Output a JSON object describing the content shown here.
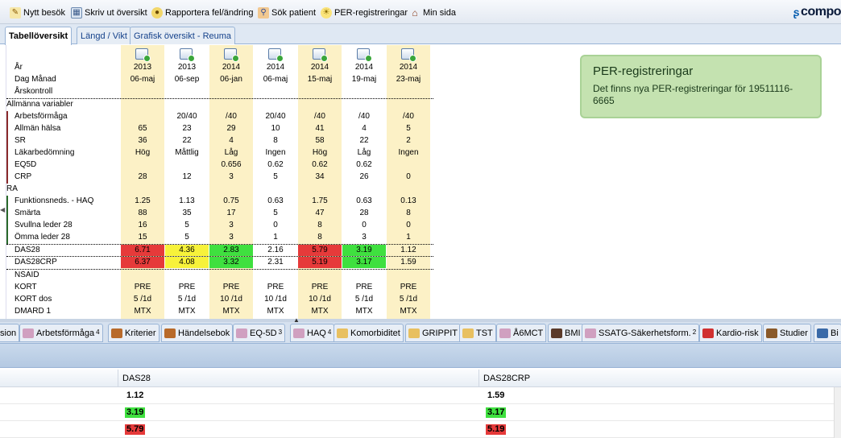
{
  "toolbar": {
    "items": [
      {
        "label": "Nytt besök",
        "icon": "pencil-icon"
      },
      {
        "label": "Skriv ut översikt",
        "icon": "table-icon"
      },
      {
        "label": "Rapportera fel/ändring",
        "icon": "report-icon"
      },
      {
        "label": "Sök patient",
        "icon": "search-person-icon"
      },
      {
        "label": "PER-registreringar",
        "icon": "lightbulb-icon"
      },
      {
        "label": "Min sida",
        "icon": "home-icon"
      }
    ],
    "brand": "compo"
  },
  "tabs": [
    {
      "label": "Tabellöversikt",
      "active": true
    },
    {
      "label": "Längd / Vikt",
      "active": false
    },
    {
      "label": "Grafisk översikt - Reuma",
      "active": false
    }
  ],
  "grid": {
    "header_labels": {
      "year": "År",
      "daymonth": "Dag Månad",
      "annual": "Årskontroll"
    },
    "columns": [
      {
        "year": "2013",
        "date": "06-maj"
      },
      {
        "year": "2013",
        "date": "06-sep"
      },
      {
        "year": "2014",
        "date": "06-jan"
      },
      {
        "year": "2014",
        "date": "06-maj"
      },
      {
        "year": "2014",
        "date": "15-maj"
      },
      {
        "year": "2014",
        "date": "19-maj"
      },
      {
        "year": "2014",
        "date": "23-maj"
      }
    ],
    "rows": [
      {
        "label": "Allmänna variabler",
        "values": [
          "",
          "",
          "",
          "",
          "",
          "",
          ""
        ]
      },
      {
        "label": "Arbetsförmåga",
        "values": [
          "",
          "20/40",
          "/40",
          "20/40",
          "/40",
          "/40",
          "/40"
        ]
      },
      {
        "label": "Allmän hälsa",
        "values": [
          "65",
          "23",
          "29",
          "10",
          "41",
          "4",
          "5"
        ]
      },
      {
        "label": "SR",
        "values": [
          "36",
          "22",
          "4",
          "8",
          "58",
          "22",
          "2"
        ]
      },
      {
        "label": "Läkarbedömning",
        "values": [
          "Hög",
          "Måttlig",
          "Låg",
          "Ingen",
          "Hög",
          "Låg",
          "Ingen"
        ]
      },
      {
        "label": "EQ5D",
        "values": [
          "",
          "",
          "0.656",
          "0.62",
          "0.62",
          "0.62",
          ""
        ]
      },
      {
        "label": "CRP",
        "values": [
          "28",
          "12",
          "3",
          "5",
          "34",
          "26",
          "0"
        ]
      },
      {
        "label": "RA",
        "values": [
          "",
          "",
          "",
          "",
          "",
          "",
          ""
        ]
      },
      {
        "label": "Funktionsneds. - HAQ",
        "values": [
          "1.25",
          "1.13",
          "0.75",
          "0.63",
          "1.75",
          "0.63",
          "0.13"
        ]
      },
      {
        "label": "Smärta",
        "values": [
          "88",
          "35",
          "17",
          "5",
          "47",
          "28",
          "8"
        ]
      },
      {
        "label": "Svullna leder 28",
        "values": [
          "16",
          "5",
          "3",
          "0",
          "8",
          "0",
          "0"
        ]
      },
      {
        "label": "Ömma leder 28",
        "values": [
          "15",
          "5",
          "3",
          "1",
          "8",
          "3",
          "1"
        ]
      },
      {
        "label": "DAS28",
        "values": [
          "6.71",
          "4.36",
          "2.83",
          "2.16",
          "5.79",
          "3.19",
          "1.12"
        ]
      },
      {
        "label": "DAS28CRP",
        "values": [
          "6.37",
          "4.08",
          "3.32",
          "2.31",
          "5.19",
          "3.17",
          "1.59"
        ]
      },
      {
        "label": "NSAID",
        "values": [
          "",
          "",
          "",
          "",
          "",
          "",
          ""
        ]
      },
      {
        "label": "KORT",
        "values": [
          "PRE",
          "PRE",
          "PRE",
          "PRE",
          "PRE",
          "PRE",
          "PRE"
        ]
      },
      {
        "label": "KORT dos",
        "values": [
          "5 /1d",
          "5 /1d",
          "10 /1d",
          "10 /1d",
          "10 /1d",
          "5 /1d",
          "5 /1d"
        ]
      },
      {
        "label": "DMARD 1",
        "values": [
          "MTX",
          "MTX",
          "MTX",
          "MTX",
          "MTX",
          "MTX",
          "MTX"
        ]
      }
    ],
    "colors": {
      "red": "#e63a3a",
      "yellow": "#f7f23a",
      "green": "#3fe03f",
      "column_bg": "#fcf1c6"
    }
  },
  "info": {
    "title": "PER-registreringar",
    "body": "Det finns nya PER-registreringar för 19511116-6665"
  },
  "bottom_tabs": [
    {
      "label": "sion",
      "badge": ""
    },
    {
      "label": "Arbetsförmåga",
      "badge": "4"
    },
    {
      "label": "Kriterier",
      "badge": ""
    },
    {
      "label": "Händelsebok",
      "badge": ""
    },
    {
      "label": "EQ-5D",
      "badge": "3"
    },
    {
      "label": "HAQ",
      "badge": "4"
    },
    {
      "label": "Komorbiditet",
      "badge": ""
    },
    {
      "label": "GRIPPIT",
      "badge": ""
    },
    {
      "label": "TST",
      "badge": ""
    },
    {
      "label": "Å6MCT",
      "badge": ""
    },
    {
      "label": "BMI",
      "badge": ""
    },
    {
      "label": "SSATG-Säkerhetsform.",
      "badge": "2"
    },
    {
      "label": "Kardio-risk",
      "badge": ""
    },
    {
      "label": "Studier",
      "badge": ""
    },
    {
      "label": "Bi",
      "badge": ""
    }
  ],
  "lower_table": {
    "headers": [
      "DAS28",
      "DAS28CRP"
    ],
    "rows": [
      {
        "das28": "1.12",
        "das28crp": "1.59"
      },
      {
        "das28": "3.19",
        "das28crp": "3.17"
      },
      {
        "das28": "5.79",
        "das28crp": "5.19"
      }
    ]
  }
}
